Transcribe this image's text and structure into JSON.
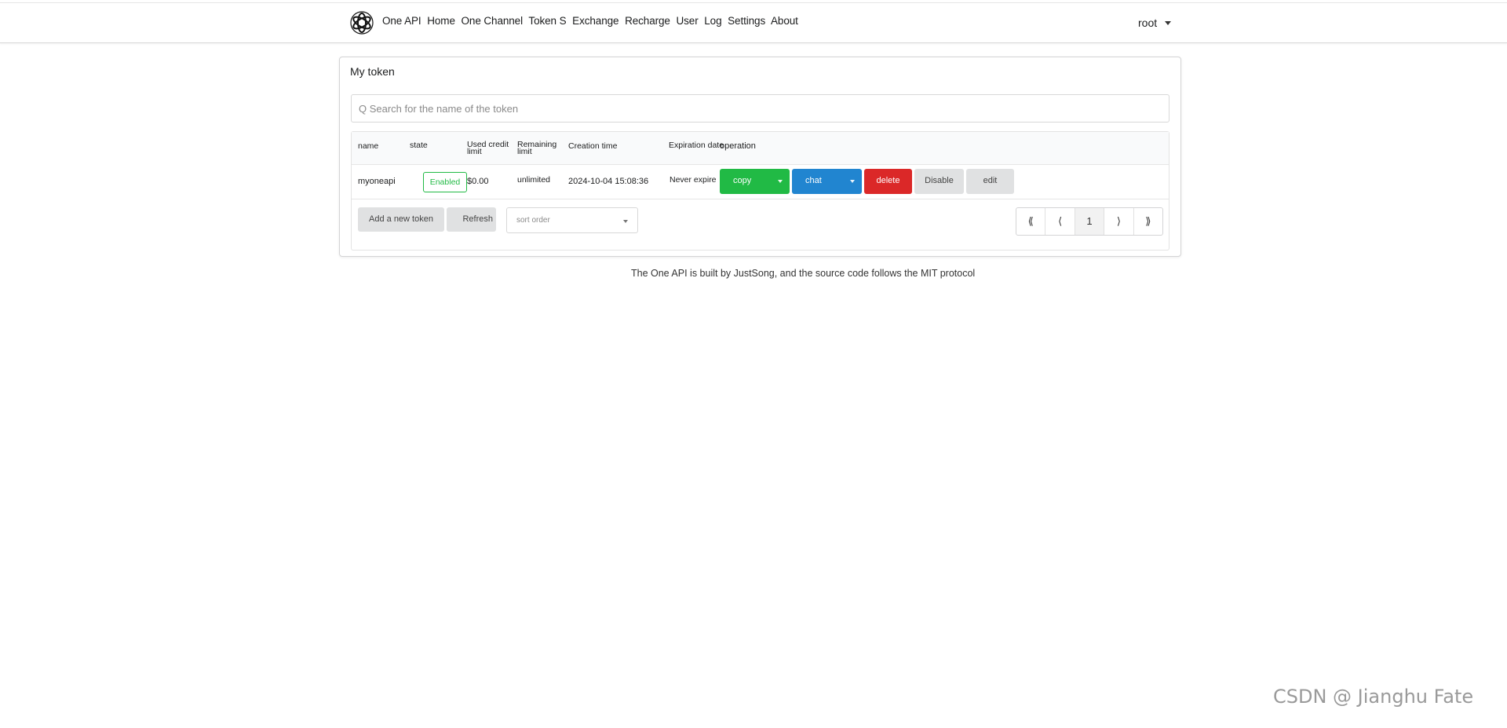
{
  "nav": {
    "items": [
      "One API",
      "Home",
      "One Channel",
      "Token S",
      "Exchange",
      "Recharge",
      "User",
      "Log",
      "Settings",
      "About"
    ],
    "user": "root"
  },
  "page": {
    "title": "My token",
    "search_placeholder": "Q Search for the name of the token"
  },
  "table": {
    "headers": {
      "name": "name",
      "state": "state",
      "used": "Used credit limit",
      "remaining": "Remaining limit",
      "created": "Creation time",
      "expires": "Expiration date",
      "operation": "operation"
    },
    "row": {
      "name": "myoneapi",
      "state": "Enabled",
      "used": "$0.00",
      "remaining": "unlimited",
      "created": "2024-10-04 15:08:36",
      "expires": "Never expire"
    },
    "actions": {
      "copy": "copy",
      "chat": "chat",
      "delete": "delete",
      "disable": "Disable",
      "edit": "edit"
    }
  },
  "footer_controls": {
    "add_token": "Add a new token",
    "refresh": "Refresh",
    "sort_placeholder": "sort order",
    "pager": {
      "first": "⟪",
      "prev": "⟨",
      "page": "1",
      "next": "⟩",
      "last": "⟫"
    }
  },
  "credit": "The One API is built by JustSong, and the source code follows the MIT protocol",
  "watermark": "CSDN @ Jianghu Fate",
  "colors": {
    "green": "#21ba45",
    "blue": "#2185d0",
    "red": "#db2828",
    "grey": "#e0e1e2"
  }
}
